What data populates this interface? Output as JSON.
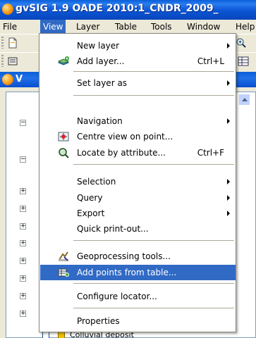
{
  "window": {
    "title": "gvSIG 1.9 OADE 2010:1_CNDR_2009_"
  },
  "menubar": {
    "items": [
      {
        "label": "File"
      },
      {
        "label": "View"
      },
      {
        "label": "Layer"
      },
      {
        "label": "Table"
      },
      {
        "label": "Tools"
      },
      {
        "label": "Window"
      },
      {
        "label": "Help"
      }
    ],
    "active": "View"
  },
  "panel": {
    "title": "V"
  },
  "view_menu": {
    "items": [
      {
        "label": "New layer",
        "submenu": true
      },
      {
        "label": "Add layer...",
        "shortcut": "Ctrl+L",
        "icon": "add-layer-icon"
      },
      {
        "label": "Set layer as",
        "submenu": true
      },
      {
        "label": "Navigation",
        "submenu": true
      },
      {
        "label": "Centre view on point...",
        "icon": "centre-view-icon"
      },
      {
        "label": "Locate by attribute...",
        "shortcut": "Ctrl+F",
        "icon": "locate-icon"
      },
      {
        "label": "Selection",
        "submenu": true
      },
      {
        "label": "Query",
        "submenu": true
      },
      {
        "label": "Export",
        "submenu": true
      },
      {
        "label": "Quick print-out..."
      },
      {
        "label": "Geoprocessing tools...",
        "icon": "geoprocessing-icon"
      },
      {
        "label": "Add points from table...",
        "icon": "add-points-icon",
        "highlighted": true
      },
      {
        "label": "Configure locator..."
      },
      {
        "label": "Properties"
      }
    ]
  },
  "toc": {
    "last_visible_layer": "Colluvial deposit"
  },
  "colors": {
    "highlight": "#316ac5",
    "titlebar": "#0a5fd8",
    "menubar": "#ece9d8"
  }
}
